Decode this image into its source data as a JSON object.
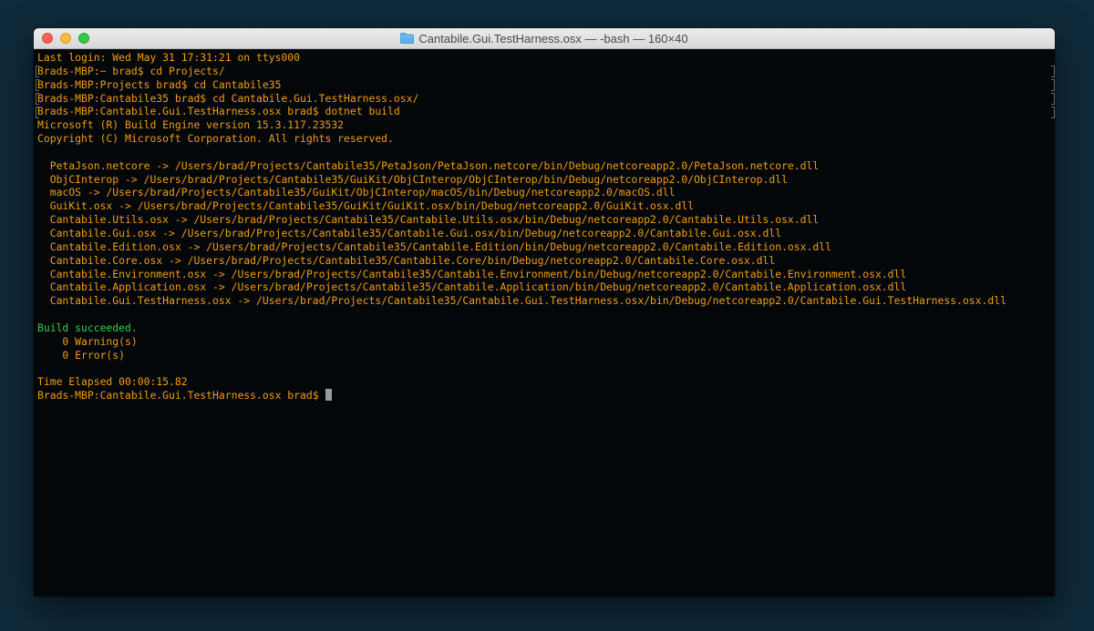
{
  "window": {
    "title": "Cantabile.Gui.TestHarness.osx — -bash — 160×40",
    "title_icon": "folder-icon"
  },
  "colors": {
    "output_text": "#f29e0a",
    "success_text": "#2fd142",
    "background": "#03070a"
  },
  "terminal": {
    "lines": [
      {
        "text": "Last login: Wed May 31 17:31:21 on ttys000"
      },
      {
        "text": "Brads-MBP:~ brad$ cd Projects/"
      },
      {
        "text": "Brads-MBP:Projects brad$ cd Cantabile35"
      },
      {
        "text": "Brads-MBP:Cantabile35 brad$ cd Cantabile.Gui.TestHarness.osx/"
      },
      {
        "text": "Brads-MBP:Cantabile.Gui.TestHarness.osx brad$ dotnet build"
      },
      {
        "text": "Microsoft (R) Build Engine version 15.3.117.23532"
      },
      {
        "text": "Copyright (C) Microsoft Corporation. All rights reserved."
      },
      {
        "text": ""
      },
      {
        "text": "  PetaJson.netcore -> /Users/brad/Projects/Cantabile35/PetaJson/PetaJson.netcore/bin/Debug/netcoreapp2.0/PetaJson.netcore.dll"
      },
      {
        "text": "  ObjCInterop -> /Users/brad/Projects/Cantabile35/GuiKit/ObjCInterop/ObjCInterop/bin/Debug/netcoreapp2.0/ObjCInterop.dll"
      },
      {
        "text": "  macOS -> /Users/brad/Projects/Cantabile35/GuiKit/ObjCInterop/macOS/bin/Debug/netcoreapp2.0/macOS.dll"
      },
      {
        "text": "  GuiKit.osx -> /Users/brad/Projects/Cantabile35/GuiKit/GuiKit.osx/bin/Debug/netcoreapp2.0/GuiKit.osx.dll"
      },
      {
        "text": "  Cantabile.Utils.osx -> /Users/brad/Projects/Cantabile35/Cantabile.Utils.osx/bin/Debug/netcoreapp2.0/Cantabile.Utils.osx.dll"
      },
      {
        "text": "  Cantabile.Gui.osx -> /Users/brad/Projects/Cantabile35/Cantabile.Gui.osx/bin/Debug/netcoreapp2.0/Cantabile.Gui.osx.dll"
      },
      {
        "text": "  Cantabile.Edition.osx -> /Users/brad/Projects/Cantabile35/Cantabile.Edition/bin/Debug/netcoreapp2.0/Cantabile.Edition.osx.dll"
      },
      {
        "text": "  Cantabile.Core.osx -> /Users/brad/Projects/Cantabile35/Cantabile.Core/bin/Debug/netcoreapp2.0/Cantabile.Core.osx.dll"
      },
      {
        "text": "  Cantabile.Environment.osx -> /Users/brad/Projects/Cantabile35/Cantabile.Environment/bin/Debug/netcoreapp2.0/Cantabile.Environment.osx.dll"
      },
      {
        "text": "  Cantabile.Application.osx -> /Users/brad/Projects/Cantabile35/Cantabile.Application/bin/Debug/netcoreapp2.0/Cantabile.Application.osx.dll"
      },
      {
        "text": "  Cantabile.Gui.TestHarness.osx -> /Users/brad/Projects/Cantabile35/Cantabile.Gui.TestHarness.osx/bin/Debug/netcoreapp2.0/Cantabile.Gui.TestHarness.osx.dll"
      },
      {
        "text": ""
      },
      {
        "text": "Build succeeded."
      },
      {
        "text": "    0 Warning(s)"
      },
      {
        "text": "    0 Error(s)"
      },
      {
        "text": ""
      },
      {
        "text": "Time Elapsed 00:00:15.82"
      }
    ],
    "prompt": "Brads-MBP:Cantabile.Gui.TestHarness.osx brad$ "
  }
}
